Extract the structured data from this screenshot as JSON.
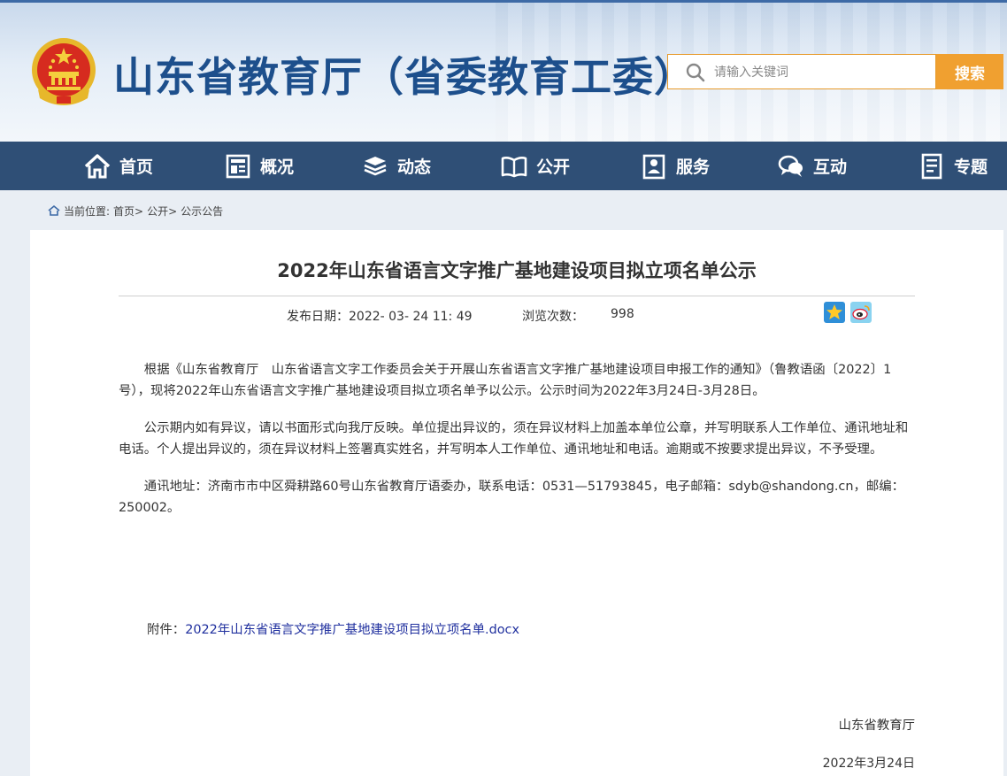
{
  "header": {
    "site_title": "山东省教育厅（省委教育工委）",
    "search": {
      "placeholder": "请输入关键词",
      "button_label": "搜索"
    },
    "colors": {
      "title": "#1d4f8c",
      "search_accent": "#f0a030",
      "nav_bg": "#2f4f76"
    }
  },
  "nav": {
    "items": [
      {
        "label": "首页",
        "icon": "home-icon"
      },
      {
        "label": "概况",
        "icon": "overview-icon"
      },
      {
        "label": "动态",
        "icon": "news-stack-icon"
      },
      {
        "label": "公开",
        "icon": "open-book-icon"
      },
      {
        "label": "服务",
        "icon": "service-icon"
      },
      {
        "label": "互动",
        "icon": "chat-icon"
      },
      {
        "label": "专题",
        "icon": "topic-icon"
      }
    ]
  },
  "breadcrumb": {
    "prefix": "当前位置:",
    "items": [
      "首页>",
      "公开>",
      "公示公告"
    ]
  },
  "article": {
    "title": "2022年山东省语言文字推广基地建设项目拟立项名单公示",
    "publish_label": "发布日期：",
    "publish_date": "2022- 03- 24 11: 49",
    "views_label": "浏览次数：",
    "views": "998",
    "share_icons": [
      "qzone-star-icon",
      "weibo-icon"
    ],
    "paragraphs": [
      "根据《山东省教育厅　山东省语言文字工作委员会关于开展山东省语言文字推广基地建设项目申报工作的通知》（鲁教语函〔2022〕1号），现将2022年山东省语言文字推广基地建设项目拟立项名单予以公示。公示时间为2022年3月24日-3月28日。",
      "公示期内如有异议，请以书面形式向我厅反映。单位提出异议的，须在异议材料上加盖本单位公章，并写明联系人工作单位、通讯地址和电话。个人提出异议的，须在异议材料上签署真实姓名，并写明本人工作单位、通讯地址和电话。逾期或不按要求提出异议，不予受理。",
      "通讯地址：济南市市中区舜耕路60号山东省教育厅语委办，联系电话：0531—51793845，电子邮箱：sdyb@shandong.cn，邮编：250002。"
    ],
    "attachment_label": "附件：",
    "attachment_link": "2022年山东省语言文字推广基地建设项目拟立项名单.docx",
    "signature": "山东省教育厅",
    "sign_date": "2022年3月24日"
  }
}
